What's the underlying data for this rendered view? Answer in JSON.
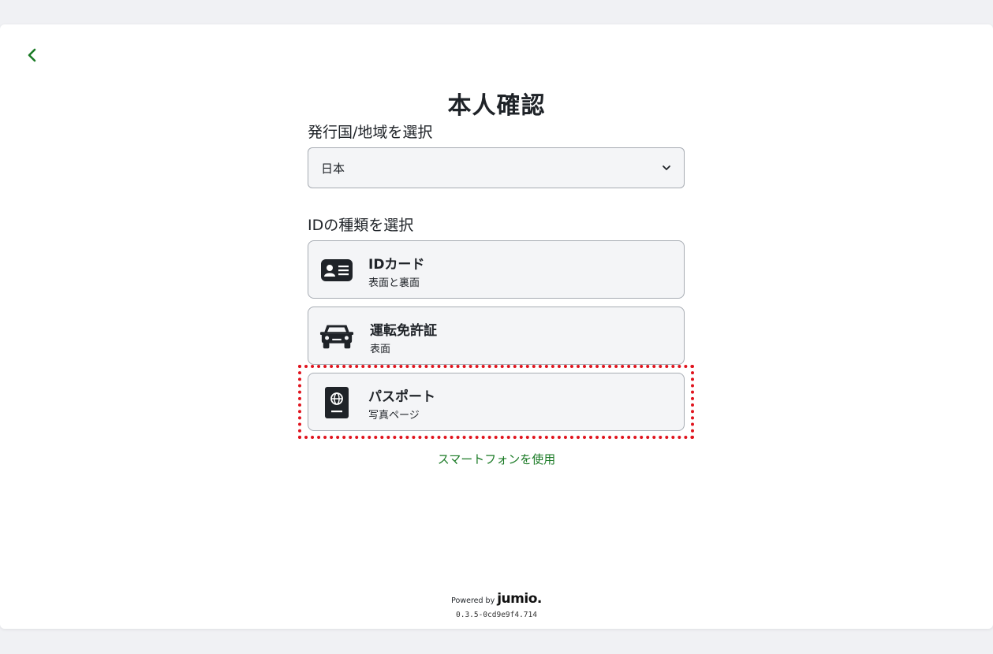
{
  "page": {
    "title": "本人確認"
  },
  "country": {
    "label": "発行国/地域を選択",
    "selected": "日本"
  },
  "id_type": {
    "label": "IDの種類を選択",
    "options": [
      {
        "title": "IDカード",
        "subtitle": "表面と裏面",
        "icon": "id-card-icon"
      },
      {
        "title": "運転免許証",
        "subtitle": "表面",
        "icon": "car-icon"
      },
      {
        "title": "パスポート",
        "subtitle": "写真ページ",
        "icon": "passport-icon"
      }
    ]
  },
  "smartphone_link": "スマートフォンを使用",
  "footer": {
    "powered_by": "Powered by",
    "brand": "jumio.",
    "version": "0.3.5-0cd9e9f4.714"
  },
  "colors": {
    "accent": "#1a7a25",
    "highlight": "#e0141e",
    "icon_dark": "#1f2328"
  }
}
